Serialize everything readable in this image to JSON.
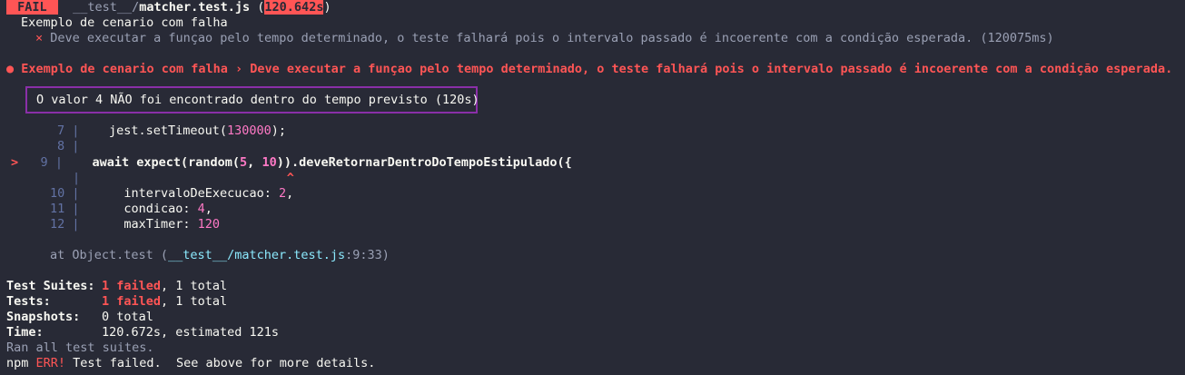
{
  "header": {
    "status": "FAIL",
    "path_prefix": "__test__/",
    "file": "matcher.test.js",
    "paren_open": "(",
    "duration": "120.642s",
    "paren_close": ")"
  },
  "suite": {
    "name": "Exemplo de cenario com falha",
    "fail_mark": "×",
    "test_title": "Deve executar a funçao pelo tempo determinado, o teste falhará pois o intervalo passado é incoerente com a condição esperada. (120075ms)"
  },
  "failure": {
    "bullet": "●",
    "title": "Exemplo de cenario com falha › Deve executar a funçao pelo tempo determinado, o teste falhará pois o intervalo passado é incoerente com a condição esperada.",
    "message": "O valor 4 NÃO foi encontrado dentro do tempo previsto (120s)"
  },
  "code": {
    "l7_num": "7",
    "l7_a": "jest.setTimeout(",
    "l7_num_val": "130000",
    "l7_b": ");",
    "l8_num": "8",
    "marker": ">",
    "l9_num": "9",
    "l9_a": "await expect(random(",
    "l9_n1": "5",
    "l9_c": ", ",
    "l9_n2": "10",
    "l9_b": ")).deveRetornarDentroDoTempoEstipulado({",
    "caret": "^",
    "l10_num": "10",
    "l10_a": "intervaloDeExecucao: ",
    "l10_v": "2",
    "l10_b": ",",
    "l11_num": "11",
    "l11_a": "condicao: ",
    "l11_v": "4",
    "l11_b": ",",
    "l12_num": "12",
    "l12_a": "maxTimer: ",
    "l12_v": "120",
    "pipe": "|"
  },
  "stack": {
    "prefix": "at Object.test (",
    "path": "__test__/matcher.test.js",
    "loc": ":9:33",
    "suffix": ")"
  },
  "summary": {
    "suites_label": "Test Suites:",
    "suites_failed": "1 failed",
    "suites_total": ", 1 total",
    "tests_label": "Tests:",
    "tests_failed": "1 failed",
    "tests_total": ", 1 total",
    "snapshots_label": "Snapshots:",
    "snapshots_value": "0 total",
    "time_label": "Time:",
    "time_value": "120.672s, estimated 121s",
    "ran": "Ran all test suites."
  },
  "npm": {
    "prefix": "npm ",
    "err": "ERR!",
    "message": " Test failed.  See above for more details."
  },
  "colors": {
    "background": "#282a36",
    "fail": "#ff5555",
    "number": "#ff79c6",
    "path": "#8be9fd",
    "box_border": "#8a2fa8"
  }
}
